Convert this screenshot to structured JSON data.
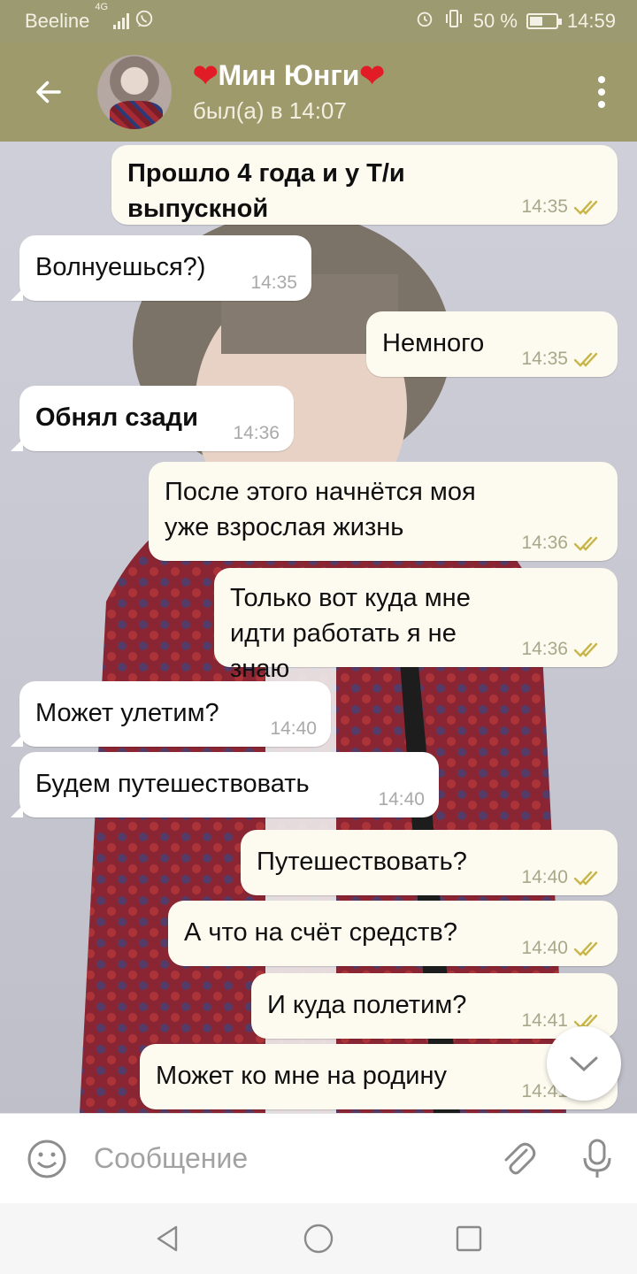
{
  "status_bar": {
    "carrier": "Beeline",
    "network": "4G",
    "battery": "50 %",
    "battery_level": 0.5,
    "time": "14:59"
  },
  "header": {
    "contact_name": "Мин Юнги",
    "last_seen": "был(а) в 14:07"
  },
  "messages": [
    {
      "text": "Прошло 4 года и у Т/и выпускной",
      "time": "14:35",
      "dir": "out",
      "bold": true
    },
    {
      "text": "Волнуешься?)",
      "time": "14:35",
      "dir": "in",
      "bold": false
    },
    {
      "text": "Немного",
      "time": "14:35",
      "dir": "out",
      "bold": false
    },
    {
      "text": "Обнял сзади",
      "time": "14:36",
      "dir": "in",
      "bold": true
    },
    {
      "text": "После этого начнётся моя уже взрослая жизнь",
      "time": "14:36",
      "dir": "out",
      "bold": false
    },
    {
      "text": "Только вот куда мне идти работать я не знаю",
      "time": "14:36",
      "dir": "out",
      "bold": false
    },
    {
      "text": "Может улетим?",
      "time": "14:40",
      "dir": "in",
      "bold": false
    },
    {
      "text": "Будем путешествовать",
      "time": "14:40",
      "dir": "in",
      "bold": false
    },
    {
      "text": "Путешествовать?",
      "time": "14:40",
      "dir": "out",
      "bold": false
    },
    {
      "text": "А что на счёт средств?",
      "time": "14:40",
      "dir": "out",
      "bold": false
    },
    {
      "text": "И куда полетим?",
      "time": "14:41",
      "dir": "out",
      "bold": false
    },
    {
      "text": "Может ко мне на родину",
      "time": "14:41",
      "dir": "out",
      "bold": false
    }
  ],
  "input": {
    "placeholder": "Сообщение"
  },
  "icons": {
    "back": "arrow-left-icon",
    "menu": "more-vert-icon",
    "emoji": "smiley-icon",
    "attach": "paperclip-icon",
    "mic": "microphone-icon",
    "scroll": "chevron-down-icon",
    "read": "double-check-icon"
  },
  "colors": {
    "header": "#9e9a6c",
    "heart": "#e21c26",
    "check": "#c9b64a"
  }
}
